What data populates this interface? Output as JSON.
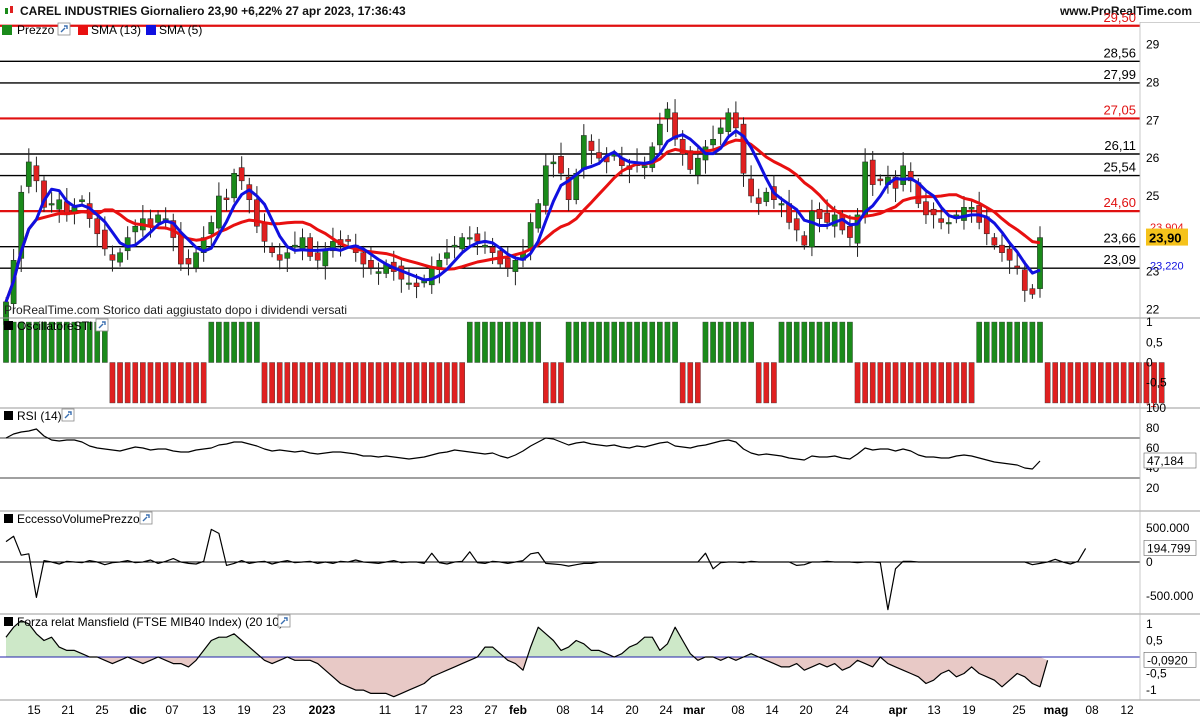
{
  "header": {
    "title": "CAREL INDUSTRIES Giornaliero 23,90 +6,22% 27 apr 2023, 17:36:43",
    "website": "www.ProRealTime.com"
  },
  "colors": {
    "up": "#1a8a1a",
    "down": "#e02020",
    "sma13": "#e81010",
    "sma5": "#1010e0",
    "levelRed": "#e01010",
    "levelBlack": "#000000",
    "currentBg": "#f5c21b"
  },
  "chart_data": [
    {
      "type": "candlestick",
      "legend": [
        "Prezzo",
        "SMA (13)",
        "SMA (5)"
      ],
      "watermark": "ProRealTime.com  Storico dati aggiustato dopo i dividendi versati",
      "ylim": [
        21.8,
        29.6
      ],
      "yticks": [
        "22",
        "23",
        "25",
        "26",
        "27",
        "28",
        "29"
      ],
      "levels": [
        {
          "value": 29.5,
          "label": "29,50",
          "color": "red"
        },
        {
          "value": 28.56,
          "label": "28,56",
          "color": "black"
        },
        {
          "value": 27.99,
          "label": "27,99",
          "color": "black"
        },
        {
          "value": 27.05,
          "label": "27,05",
          "color": "red"
        },
        {
          "value": 26.11,
          "label": "26,11",
          "color": "black"
        },
        {
          "value": 25.54,
          "label": "25,54",
          "color": "black"
        },
        {
          "value": 24.6,
          "label": "24,60",
          "color": "red"
        },
        {
          "value": 23.66,
          "label": "23,66",
          "color": "black"
        },
        {
          "value": 23.09,
          "label": "23,09",
          "color": "black"
        }
      ],
      "last_labels": {
        "sma13": "23,904",
        "price": "23,90",
        "sma5": "23,220"
      },
      "x_labels": [
        "15",
        "21",
        "25",
        "dic",
        "07",
        "13",
        "19",
        "23",
        "2023",
        "11",
        "17",
        "23",
        "27",
        "feb",
        "08",
        "14",
        "20",
        "24",
        "mar",
        "08",
        "14",
        "20",
        "24",
        "apr",
        "13",
        "19",
        "25",
        "mag",
        "08",
        "12"
      ],
      "close": [
        22.2,
        23.3,
        25.1,
        25.9,
        25.4,
        24.7,
        24.8,
        24.9,
        24.5,
        24.7,
        24.9,
        24.4,
        24.0,
        23.6,
        23.3,
        23.5,
        23.9,
        24.2,
        24.4,
        24.2,
        24.5,
        24.4,
        23.9,
        23.2,
        23.2,
        23.5,
        23.9,
        24.3,
        25.0,
        24.9,
        25.6,
        25.4,
        24.9,
        24.2,
        23.8,
        23.5,
        23.3,
        23.5,
        23.7,
        23.9,
        23.4,
        23.3,
        23.6,
        23.8,
        23.7,
        23.8,
        23.5,
        23.2,
        23.1,
        23.0,
        23.2,
        23.0,
        22.8,
        22.7,
        22.6,
        22.8,
        23.1,
        23.3,
        23.5,
        23.7,
        23.9,
        23.9,
        23.8,
        23.7,
        23.5,
        23.2,
        23.1,
        23.3,
        23.5,
        24.3,
        24.8,
        25.8,
        25.9,
        25.6,
        24.9,
        25.6,
        26.6,
        26.2,
        26.0,
        25.9,
        26.1,
        25.8,
        25.7,
        25.9,
        25.8,
        26.3,
        26.9,
        27.3,
        26.5,
        26.1,
        25.7,
        26.0,
        26.3,
        26.5,
        26.8,
        27.2,
        26.8,
        25.6,
        25.0,
        24.8,
        25.1,
        24.9,
        24.8,
        24.3,
        24.1,
        23.7,
        24.6,
        24.4,
        24.3,
        24.5,
        24.1,
        23.9,
        24.5,
        25.9,
        25.3,
        25.4,
        25.5,
        25.2,
        25.8,
        25.4,
        24.8,
        24.5,
        24.5,
        24.3,
        24.3,
        24.5,
        24.7,
        24.7,
        24.3,
        24.0,
        23.7,
        23.5,
        23.3,
        23.1,
        22.5,
        22.4,
        23.9
      ]
    },
    {
      "type": "bar",
      "name": "OscillatoreSTI",
      "ylim": [
        -1.1,
        1.1
      ],
      "yticks": [
        "1",
        "0,5",
        "0",
        "-0,5",
        "-1"
      ],
      "last_label": "-1",
      "values": [
        1,
        1,
        1,
        1,
        1,
        1,
        1,
        1,
        1,
        1,
        1,
        1,
        1,
        1,
        -1,
        -1,
        -1,
        -1,
        -1,
        -1,
        -1,
        -1,
        -1,
        -1,
        -1,
        -1,
        -1,
        1,
        1,
        1,
        1,
        1,
        1,
        1,
        -1,
        -1,
        -1,
        -1,
        -1,
        -1,
        -1,
        -1,
        -1,
        -1,
        -1,
        -1,
        -1,
        -1,
        -1,
        -1,
        -1,
        -1,
        -1,
        -1,
        -1,
        -1,
        -1,
        -1,
        -1,
        -1,
        -1,
        1,
        1,
        1,
        1,
        1,
        1,
        1,
        1,
        1,
        1,
        -1,
        -1,
        -1,
        1,
        1,
        1,
        1,
        1,
        1,
        1,
        1,
        1,
        1,
        1,
        1,
        1,
        1,
        1,
        -1,
        -1,
        -1,
        1,
        1,
        1,
        1,
        1,
        1,
        1,
        -1,
        -1,
        -1,
        1,
        1,
        1,
        1,
        1,
        1,
        1,
        1,
        1,
        1,
        -1,
        -1,
        -1,
        -1,
        -1,
        -1,
        -1,
        -1,
        -1,
        -1,
        -1,
        -1,
        -1,
        -1,
        -1,
        -1,
        1,
        1,
        1,
        1,
        1,
        1,
        1,
        1,
        1,
        -1,
        -1,
        -1,
        -1,
        -1,
        -1,
        -1,
        -1,
        -1,
        -1,
        -1,
        -1,
        -1,
        -1,
        -1,
        -1
      ]
    },
    {
      "type": "line",
      "name": "RSI (14)",
      "ylim": [
        0,
        100
      ],
      "yticks": [
        "100",
        "80",
        "60",
        "40",
        "20"
      ],
      "last_label": "47,184",
      "values": [
        70,
        74,
        76,
        77,
        79,
        72,
        68,
        67,
        68,
        68,
        66,
        62,
        60,
        59,
        58,
        57,
        59,
        61,
        60,
        58,
        59,
        59,
        57,
        56,
        56,
        58,
        59,
        60,
        63,
        64,
        66,
        66,
        64,
        62,
        59,
        57,
        58,
        57,
        56,
        57,
        55,
        54,
        55,
        56,
        56,
        55,
        54,
        52,
        52,
        51,
        52,
        51,
        50,
        49,
        50,
        51,
        53,
        55,
        56,
        58,
        57,
        56,
        55,
        54,
        55,
        52,
        50,
        53,
        57,
        62,
        66,
        70,
        69,
        66,
        63,
        65,
        66,
        64,
        63,
        62,
        63,
        61,
        60,
        62,
        61,
        63,
        65,
        66,
        62,
        61,
        60,
        62,
        63,
        65,
        67,
        68,
        66,
        59,
        55,
        53,
        54,
        53,
        52,
        50,
        49,
        48,
        52,
        51,
        51,
        52,
        50,
        49,
        54,
        60,
        58,
        59,
        59,
        57,
        59,
        57,
        53,
        51,
        51,
        50,
        50,
        52,
        53,
        52,
        50,
        48,
        46,
        45,
        44,
        43,
        40,
        39,
        47
      ]
    },
    {
      "type": "line",
      "name": "EccessoVolumePrezzo",
      "ylim": [
        -750000,
        750000
      ],
      "yticks": [
        "500.000",
        "0",
        "-500.000"
      ],
      "last_label": "194.799",
      "values": [
        300000,
        380000,
        100000,
        120000,
        -520000,
        20000,
        0,
        -30000,
        10000,
        0,
        -10000,
        20000,
        0,
        -40000,
        -10000,
        0,
        20000,
        -10000,
        0,
        30000,
        -20000,
        10000,
        50000,
        0,
        -20000,
        -30000,
        10000,
        480000,
        420000,
        -50000,
        -20000,
        20000,
        -20000,
        0,
        10000,
        -30000,
        0,
        20000,
        -10000,
        0,
        10000,
        -20000,
        0,
        -20000,
        10000,
        0,
        30000,
        0,
        -10000,
        -20000,
        0,
        20000,
        -10000,
        0,
        0,
        -20000,
        130000,
        -10000,
        -30000,
        0,
        10000,
        150000,
        -10000,
        -20000,
        10000,
        0,
        -20000,
        0,
        20000,
        120000,
        140000,
        -20000,
        -30000,
        -40000,
        -60000,
        -40000,
        -20000,
        -20000,
        0,
        0,
        0,
        0,
        0,
        0,
        0,
        0,
        0,
        0,
        0,
        0,
        0,
        0,
        130000,
        -100000,
        -10000,
        0,
        0,
        -10000,
        10000,
        0,
        0,
        0,
        0,
        0,
        -50000,
        -40000,
        0,
        0,
        10000,
        0,
        0,
        0,
        -10000,
        0,
        0,
        -10000,
        -700000,
        -100000,
        10000,
        10000,
        0,
        0,
        0,
        0,
        0,
        0,
        0,
        0,
        0,
        0,
        0,
        0,
        0,
        0,
        0,
        -40000,
        -20000,
        0,
        40000,
        0,
        -30000,
        10000,
        200000
      ]
    },
    {
      "type": "area",
      "name": "Forza relat Mansfield (FTSE MIB40 Index) (20 10)",
      "ylim": [
        -1.3,
        1.3
      ],
      "yticks": [
        "1",
        "0,5",
        "0",
        "-0,5",
        "-1"
      ],
      "last_label": "-0,0920",
      "values": [
        0.6,
        0.9,
        1.1,
        1.0,
        0.7,
        0.5,
        0.6,
        0.3,
        0.2,
        0.2,
        0.1,
        0.0,
        0.0,
        -0.1,
        -0.2,
        -0.1,
        0.0,
        -0.1,
        -0.2,
        -0.1,
        0.0,
        -0.1,
        -0.2,
        -0.2,
        -0.3,
        -0.1,
        0.2,
        0.5,
        0.6,
        0.6,
        0.7,
        0.5,
        0.3,
        0.1,
        -0.1,
        -0.2,
        -0.1,
        0.0,
        -0.1,
        -0.1,
        -0.1,
        -0.2,
        -0.4,
        -0.6,
        -0.8,
        -0.9,
        -1.0,
        -1.0,
        -1.1,
        -1.1,
        -1.1,
        -1.2,
        -1.1,
        -1.0,
        -0.9,
        -0.8,
        -0.6,
        -0.5,
        -0.4,
        -0.3,
        -0.2,
        -0.1,
        0.0,
        0.3,
        0.3,
        0.1,
        -0.1,
        -0.2,
        -0.4,
        0.3,
        0.9,
        0.7,
        0.5,
        0.2,
        0.3,
        0.5,
        0.4,
        0.2,
        0.2,
        0.1,
        0.0,
        0.1,
        0.3,
        0.4,
        0.6,
        0.6,
        0.2,
        0.4,
        0.9,
        0.5,
        0.1,
        -0.1,
        0.0,
        0.0,
        -0.1,
        0.0,
        -0.1,
        0.0,
        0.1,
        0.0,
        -0.1,
        -0.2,
        -0.3,
        -0.3,
        -0.2,
        -0.4,
        -0.3,
        -0.2,
        -0.3,
        -0.2,
        -0.4,
        -0.3,
        -0.1,
        -0.2,
        -0.3,
        0.0,
        -0.2,
        -0.3,
        -0.4,
        -0.5,
        -0.6,
        -0.8,
        -0.7,
        -0.5,
        -0.4,
        -0.6,
        -0.5,
        -0.3,
        -0.5,
        -0.6,
        -0.7,
        -0.9,
        -0.7,
        -0.5,
        -0.6,
        -0.8,
        -0.9,
        -0.1
      ]
    }
  ]
}
